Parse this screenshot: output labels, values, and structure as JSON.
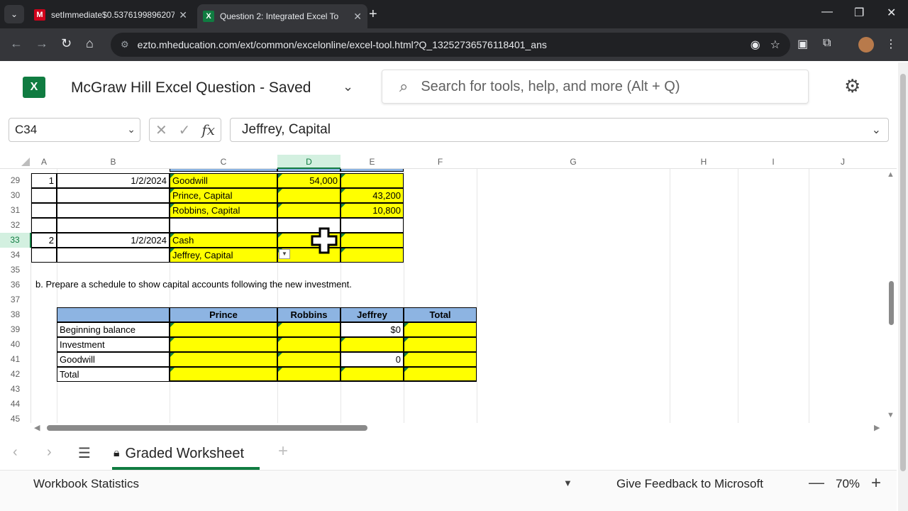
{
  "browser": {
    "tabs": [
      {
        "title": "setImmediate$0.5376199896207",
        "favicon": "M",
        "favicon_color": "#d0021b"
      },
      {
        "title": "Question 2: Integrated Excel To",
        "favicon": "X",
        "favicon_color": "#107c41"
      }
    ],
    "url": "ezto.mheducation.com/ext/common/excelonline/excel-tool.html?Q_13252736576118401_ans"
  },
  "header": {
    "app_title": "McGraw Hill Excel Question  -  Saved",
    "search_placeholder": "Search for tools, help, and more (Alt + Q)"
  },
  "formula_bar": {
    "name_box": "C34",
    "formula": "Jeffrey, Capital"
  },
  "columns": [
    "A",
    "B",
    "C",
    "D",
    "E",
    "F",
    "G",
    "H",
    "I",
    "J"
  ],
  "selected_column": "D",
  "selected_row": 33,
  "rows": [
    "29",
    "30",
    "31",
    "32",
    "33",
    "34",
    "35",
    "36",
    "37",
    "38",
    "39",
    "40",
    "41",
    "42",
    "43",
    "44",
    "45"
  ],
  "journal": {
    "r29": {
      "a": "1",
      "b": "1/2/2024",
      "c": "Goodwill",
      "d": "54,000",
      "e": ""
    },
    "r30": {
      "c": "Prince, Capital",
      "e": "43,200"
    },
    "r31": {
      "c": "Robbins, Capital",
      "e": "10,800"
    },
    "r33": {
      "a": "2",
      "b": "1/2/2024",
      "c": "Cash"
    },
    "r34": {
      "c": "Jeffrey, Capital"
    }
  },
  "instruction": "b. Prepare a schedule to show capital accounts following the new investment.",
  "schedule": {
    "headers": [
      "Prince",
      "Robbins",
      "Jeffrey",
      "Total"
    ],
    "rows": [
      {
        "label": "Beginning balance",
        "jeffrey": "$0"
      },
      {
        "label": "Investment",
        "jeffrey": ""
      },
      {
        "label": "Goodwill",
        "jeffrey": "0"
      },
      {
        "label": "Total",
        "jeffrey": ""
      }
    ]
  },
  "sheet_tab": "Graded Worksheet",
  "status": {
    "left": "Workbook Statistics",
    "feedback": "Give Feedback to Microsoft",
    "zoom": "70%"
  }
}
